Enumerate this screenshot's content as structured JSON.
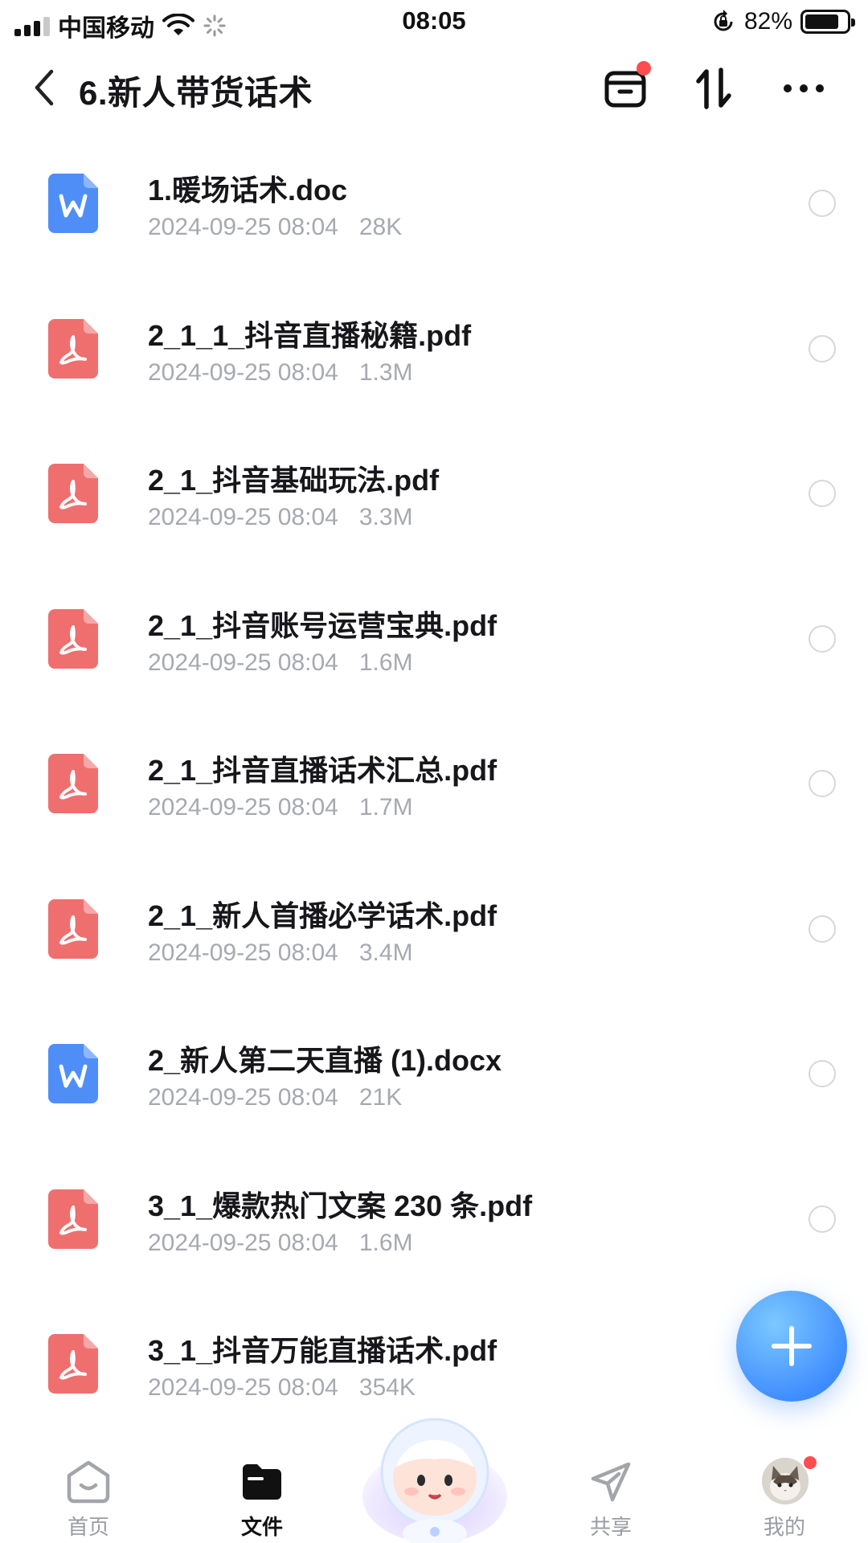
{
  "status_bar": {
    "carrier": "中国移动",
    "time": "08:05",
    "battery": "82%"
  },
  "header": {
    "title": "6.新人带货话术"
  },
  "files": [
    {
      "name": "1.暖场话术.doc",
      "date": "2024-09-25 08:04",
      "size": "28K",
      "type": "word"
    },
    {
      "name": "2_1_1_抖音直播秘籍.pdf",
      "date": "2024-09-25 08:04",
      "size": "1.3M",
      "type": "pdf"
    },
    {
      "name": "2_1_抖音基础玩法.pdf",
      "date": "2024-09-25 08:04",
      "size": "3.3M",
      "type": "pdf"
    },
    {
      "name": "2_1_抖音账号运营宝典.pdf",
      "date": "2024-09-25 08:04",
      "size": "1.6M",
      "type": "pdf"
    },
    {
      "name": "2_1_抖音直播话术汇总.pdf",
      "date": "2024-09-25 08:04",
      "size": "1.7M",
      "type": "pdf"
    },
    {
      "name": "2_1_新人首播必学话术.pdf",
      "date": "2024-09-25 08:04",
      "size": "3.4M",
      "type": "pdf"
    },
    {
      "name": "2_新人第二天直播 (1).docx",
      "date": "2024-09-25 08:04",
      "size": "21K",
      "type": "word"
    },
    {
      "name": "3_1_爆款热门文案 230 条.pdf",
      "date": "2024-09-25 08:04",
      "size": "1.6M",
      "type": "pdf"
    },
    {
      "name": "3_1_抖音万能直播话术.pdf",
      "date": "2024-09-25 08:04",
      "size": "354K",
      "type": "pdf"
    }
  ],
  "nav": {
    "home": "首页",
    "files": "文件",
    "share": "共享",
    "mine": "我的"
  },
  "colors": {
    "word_icon": "#4f8ef7",
    "pdf_icon": "#ef6f6f",
    "fab": "#3d8bff",
    "badge": "#ff4d4f"
  },
  "icons": {
    "back": "chevron-left-icon",
    "transfer": "transfer-box-icon",
    "sort": "sort-arrows-icon",
    "more": "more-dots-icon",
    "add": "plus-icon"
  }
}
